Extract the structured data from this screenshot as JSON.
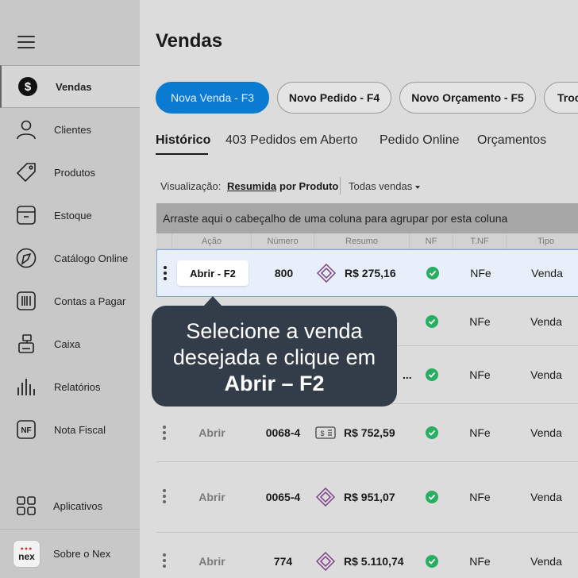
{
  "sidebar": {
    "items": [
      {
        "label": "Vendas",
        "icon": "dollar-circle-icon"
      },
      {
        "label": "Clientes",
        "icon": "user-icon"
      },
      {
        "label": "Produtos",
        "icon": "tag-icon"
      },
      {
        "label": "Estoque",
        "icon": "box-icon"
      },
      {
        "label": "Catálogo Online",
        "icon": "catalog-icon"
      },
      {
        "label": "Contas a Pagar",
        "icon": "barcode-icon"
      },
      {
        "label": "Caixa",
        "icon": "cash-register-icon"
      },
      {
        "label": "Relatórios",
        "icon": "bar-chart-icon"
      },
      {
        "label": "Nota Fiscal",
        "icon": "nf-icon"
      },
      {
        "label": "Aplicativos",
        "icon": "apps-grid-icon"
      },
      {
        "label": "Sobre o Nex",
        "icon": "nex-logo"
      }
    ],
    "logo_text": "nex"
  },
  "main": {
    "title": "Vendas",
    "buttons": [
      "Nova Venda - F3",
      "Novo Pedido - F4",
      "Novo Orçamento - F5",
      "Troc"
    ],
    "tabs": [
      "Histórico",
      "403 Pedidos em Aberto",
      "Pedido Online",
      "Orçamentos"
    ],
    "visualizacao": {
      "label": "Visualização:",
      "option_resumida": "Resumida",
      "option_produto": "por Produto",
      "filter": "Todas vendas"
    },
    "group_bar_text": "Arraste aqui o cabeçalho de uma coluna para agrupar por esta coluna",
    "columns": [
      "Ação",
      "Número",
      "Resumo",
      "NF",
      "T.NF",
      "Tipo"
    ],
    "rows": [
      {
        "action": "Abrir - F2",
        "number": "800",
        "amount": "R$ 275,16",
        "tnf": "NFe",
        "tipo": "Venda"
      },
      {
        "action": "",
        "number": "",
        "amount": "",
        "tnf": "NFe",
        "tipo": "Venda"
      },
      {
        "action": "",
        "number": "",
        "amount": "...",
        "tnf": "NFe",
        "tipo": "Venda"
      },
      {
        "action": "Abrir",
        "number": "0068-4",
        "amount": "R$ 752,59",
        "tnf": "NFe",
        "tipo": "Venda"
      },
      {
        "action": "Abrir",
        "number": "0065-4",
        "amount": "R$ 951,07",
        "tnf": "NFe",
        "tipo": "Venda"
      },
      {
        "action": "Abrir",
        "number": "774",
        "amount": "R$ 5.110,74",
        "tnf": "NFe",
        "tipo": "Venda"
      }
    ]
  },
  "tooltip": {
    "line1": "Selecione a venda",
    "line2": "desejada e clique em",
    "line3": "Abrir – F2"
  },
  "colors": {
    "primary": "#0a7bd1",
    "tooltip_bg": "#333c49",
    "check_green": "#27ae60",
    "row_highlight": "#e7f0fa"
  }
}
